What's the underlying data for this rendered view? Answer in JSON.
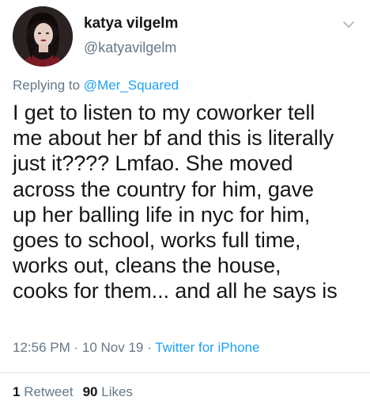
{
  "author": {
    "display_name": "katya vilgelm",
    "handle": "@katyavilgelm",
    "avatar_icon": "profile-photo"
  },
  "reply": {
    "prefix": "Replying to",
    "mention": "@Mer_Squared"
  },
  "body_lines": [
    "I get to listen to my coworker tell",
    "me about her bf and this is literally",
    "just it???? Lmfao. She moved",
    "across the country for him, gave",
    "up her balling life in nyc for him,",
    "goes to school, works full time,",
    "works out, cleans the house,",
    "cooks for them... and all he says is"
  ],
  "meta": {
    "time": "12:56 PM",
    "sep1": " · ",
    "date": "10 Nov 19",
    "sep2": " · ",
    "source": "Twitter for iPhone"
  },
  "stats": {
    "retweets_count": "1",
    "retweets_label": "Retweet",
    "likes_count": "90",
    "likes_label": "Likes"
  },
  "colors": {
    "accent": "#1da1f2",
    "text": "#14171a",
    "muted": "#657786",
    "divider": "#e1e8ed"
  },
  "icons": {
    "menu": "chevron-down-icon"
  }
}
